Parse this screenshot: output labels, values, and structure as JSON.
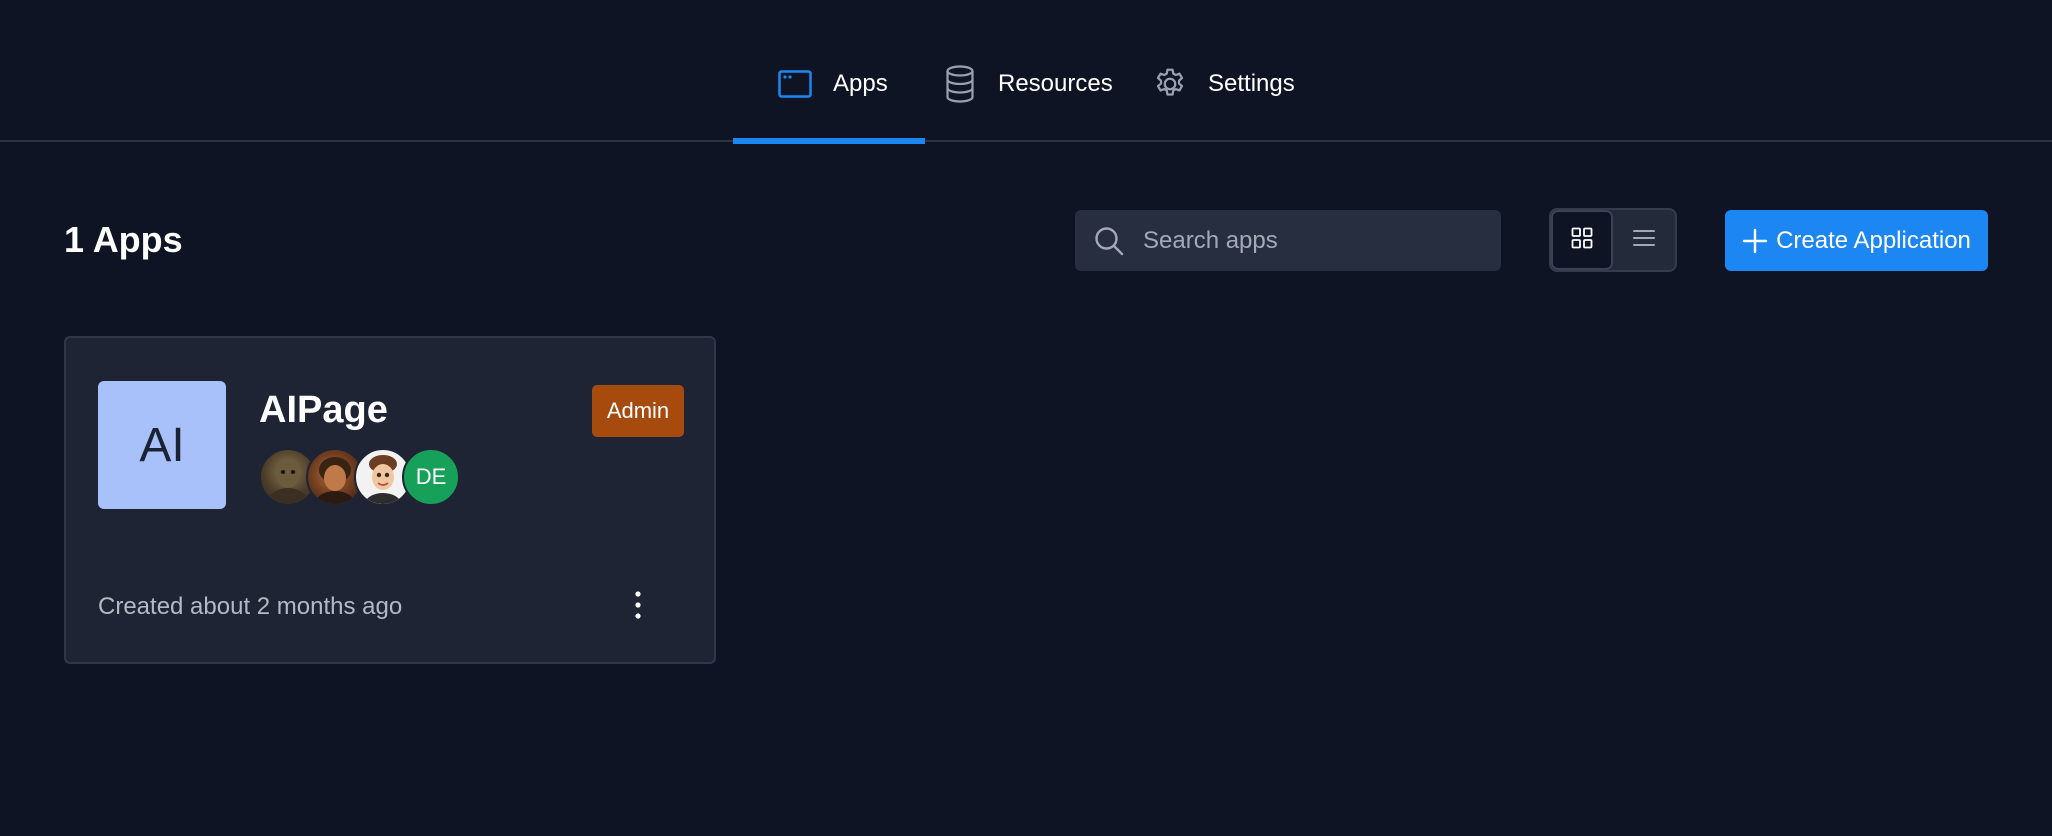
{
  "tabs": [
    {
      "label": "Apps",
      "icon": "window-icon",
      "active": true
    },
    {
      "label": "Resources",
      "icon": "database-icon",
      "active": false
    },
    {
      "label": "Settings",
      "icon": "gear-icon",
      "active": false
    }
  ],
  "header": {
    "title": "1 Apps"
  },
  "search": {
    "placeholder": "Search apps",
    "value": ""
  },
  "view_toggle": {
    "options": [
      "grid-view",
      "list-view"
    ],
    "selected": "grid-view"
  },
  "create_button": {
    "label": "Create Application"
  },
  "apps": [
    {
      "thumbnail_initials": "AI",
      "name": "AIPage",
      "role": "Admin",
      "collaborators": [
        {
          "type": "photo"
        },
        {
          "type": "photo"
        },
        {
          "type": "photo"
        },
        {
          "type": "initials",
          "initials": "DE"
        }
      ],
      "created": "Created about 2 months ago"
    }
  ],
  "colors": {
    "background": "#0e1424",
    "accent": "#1c87f2",
    "card": "#1e2434",
    "admin_badge": "#a64a0d",
    "avatar_initials": "#16a05a",
    "thumbnail": "#a9c1fb"
  }
}
